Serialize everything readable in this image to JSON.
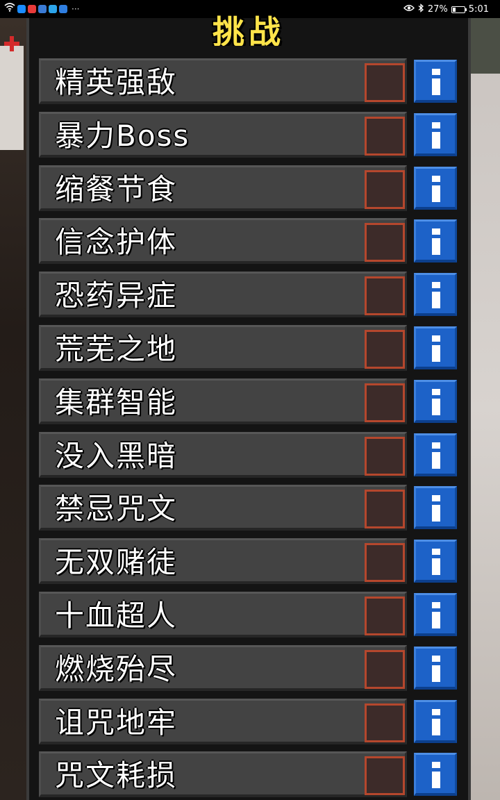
{
  "status_bar": {
    "more": "···",
    "battery": "27%",
    "battery_level": 0.27,
    "time": "5:01",
    "app_icon_colors": [
      "#1a8cff",
      "#e83a3a",
      "#3a7bd5",
      "#2ca4ea",
      "#2f7ee0"
    ]
  },
  "title": "挑战",
  "challenges": [
    {
      "label": "精英强敌",
      "checked": false
    },
    {
      "label": "暴力Boss",
      "checked": false
    },
    {
      "label": "缩餐节食",
      "checked": false
    },
    {
      "label": "信念护体",
      "checked": false
    },
    {
      "label": "恐药异症",
      "checked": false
    },
    {
      "label": "荒芜之地",
      "checked": false
    },
    {
      "label": "集群智能",
      "checked": false
    },
    {
      "label": "没入黑暗",
      "checked": false
    },
    {
      "label": "禁忌咒文",
      "checked": false
    },
    {
      "label": "无双赌徒",
      "checked": false
    },
    {
      "label": "十血超人",
      "checked": false
    },
    {
      "label": "燃烧殆尽",
      "checked": false
    },
    {
      "label": "诅咒地牢",
      "checked": false
    },
    {
      "label": "咒文耗损",
      "checked": false
    }
  ],
  "colors": {
    "title": "#ffe44a",
    "checkbox_border": "#b5472d",
    "info_button": "#1d62c8"
  }
}
